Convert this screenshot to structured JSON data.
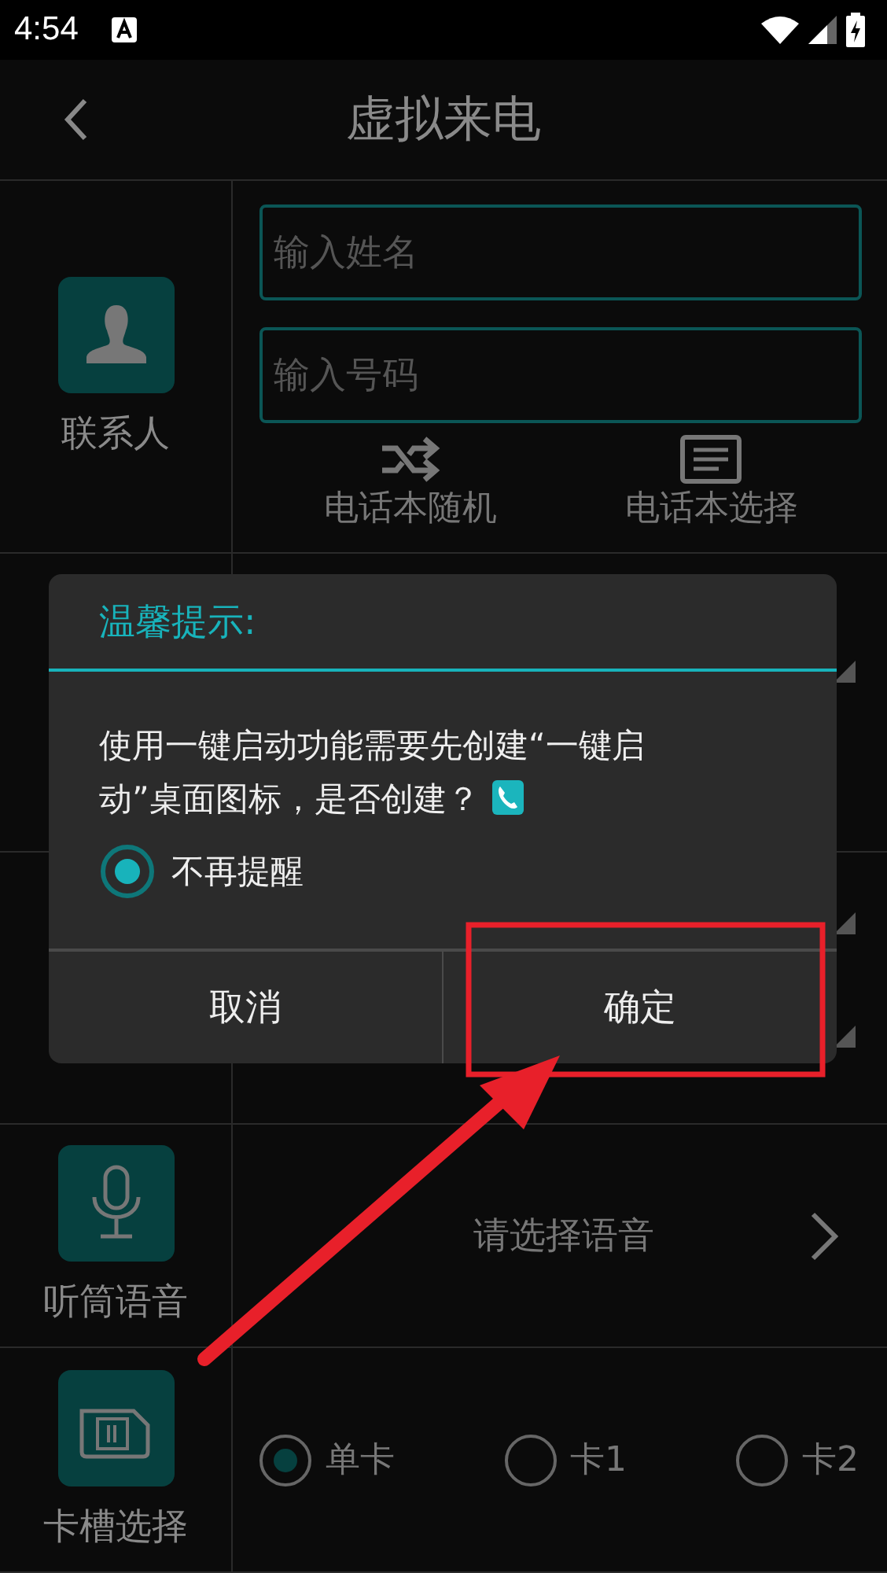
{
  "status_bar": {
    "time": "4:54"
  },
  "header": {
    "title": "虚拟来电"
  },
  "contact": {
    "label": "联系人",
    "name_field": {
      "placeholder": "输入姓名"
    },
    "number_field": {
      "placeholder": "输入号码"
    },
    "actions": [
      {
        "kind": "shuffle",
        "label": "电话本随机"
      },
      {
        "kind": "list",
        "label": "电话本选择"
      }
    ]
  },
  "voice_row": {
    "label": "听筒语音",
    "value": "请选择语音"
  },
  "sim_row": {
    "label": "卡槽选择",
    "options": [
      {
        "label": "单卡",
        "selected": true
      },
      {
        "label": "卡1",
        "selected": false
      },
      {
        "label": "卡2",
        "selected": false
      }
    ]
  },
  "dialog": {
    "title": "温馨提示:",
    "message": "使用一键启动功能需要先创建“一键启动”桌面图标，是否创建？",
    "reminder": {
      "label": "不再提醒",
      "checked": true
    },
    "buttons": [
      {
        "label": "取消"
      },
      {
        "label": "确定"
      }
    ]
  }
}
